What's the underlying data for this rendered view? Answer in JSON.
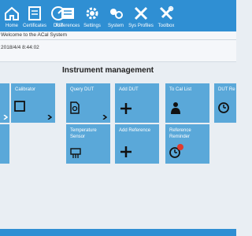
{
  "toolbar": {
    "items": [
      {
        "label": "Home",
        "icon": "home-icon"
      },
      {
        "label": "Certificates",
        "icon": "certificates-icon"
      },
      {
        "label": "DUT",
        "icon": "dut-gauge-icon"
      },
      {
        "label": "References",
        "icon": "references-icon"
      },
      {
        "label": "Settings",
        "icon": "gear-icon"
      },
      {
        "label": "System",
        "icon": "system-icon"
      },
      {
        "label": "Sys Profiles",
        "icon": "wrench-screwdriver-icon"
      },
      {
        "label": "Toolbox",
        "icon": "toolbox-icon"
      }
    ]
  },
  "welcome_text": "Welcome to the ACal System",
  "datetime": "2018/4/4 8:44:02",
  "section_title": "Instrument management",
  "tiles": [
    {
      "label": "Calibrator",
      "icon": "calibrator-icon"
    },
    {
      "label": "Query DUT",
      "icon": "query-dut-icon"
    },
    {
      "label": "Add DUT",
      "icon": "plus-icon"
    },
    {
      "label": "To Cal List",
      "icon": "cal-list-icon"
    },
    {
      "label": "DUT Re",
      "icon": "reminder-clock-icon"
    },
    {
      "label": "Temperature Sensor",
      "icon": "sensor-icon"
    },
    {
      "label": "Add Reference",
      "icon": "plus-icon"
    },
    {
      "label": "Reference Reminder",
      "icon": "reminder-clock-icon"
    }
  ],
  "colors": {
    "toolbar": "#2f8fd3",
    "tile": "#5aa8d9",
    "badge": "#e03b2f"
  }
}
